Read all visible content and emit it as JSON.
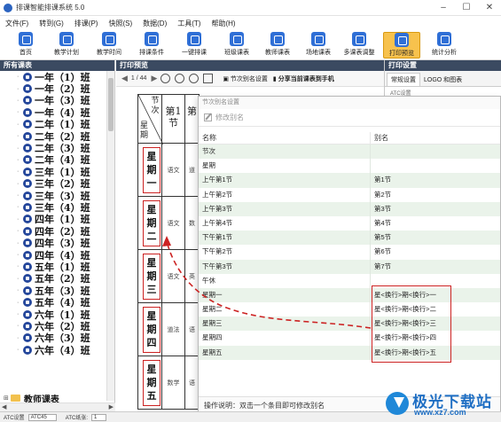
{
  "window": {
    "title": "排课智能排课系统 5.0"
  },
  "menu": [
    "文件(F)",
    "转到(G)",
    "排课(P)",
    "快照(S)",
    "数据(D)",
    "工具(T)",
    "帮助(H)"
  ],
  "toolbar": [
    {
      "label": "首页",
      "icon": "home-icon",
      "active": false
    },
    {
      "label": "教学计划",
      "icon": "plan-icon",
      "active": false
    },
    {
      "label": "教学时间",
      "icon": "clock-icon",
      "active": false
    },
    {
      "label": "排课条件",
      "icon": "conditions-icon",
      "active": false
    },
    {
      "label": "一键排课",
      "icon": "hand-icon",
      "active": false
    },
    {
      "label": "班级课表",
      "icon": "class-table-icon",
      "active": false
    },
    {
      "label": "教师课表",
      "icon": "teacher-icon",
      "active": false
    },
    {
      "label": "场地课表",
      "icon": "venue-icon",
      "active": false
    },
    {
      "label": "多课表调整",
      "icon": "adjust-icon",
      "active": false
    },
    {
      "label": "打印预览",
      "icon": "printer-icon",
      "active": true
    },
    {
      "label": "统计分析",
      "icon": "stats-icon",
      "active": false
    }
  ],
  "left_panel": {
    "header": "所有课表",
    "classes": [
      "一年（1）班",
      "一年（2）班",
      "一年（3）班",
      "一年（4）班",
      "二年（1）班",
      "二年（2）班",
      "二年（3）班",
      "二年（4）班",
      "三年（1）班",
      "三年（2）班",
      "三年（3）班",
      "三年（4）班",
      "四年（1）班",
      "四年（2）班",
      "四年（3）班",
      "四年（4）班",
      "五年（1）班",
      "五年（2）班",
      "五年（3）班",
      "五年（4）班",
      "六年（1）班",
      "六年（2）班",
      "六年（3）班",
      "六年（4）班"
    ],
    "folder": "教师课表"
  },
  "center_panel": {
    "header": "打印预览",
    "page_indicator": "1 / 44",
    "alias_button": "节次别名设置",
    "share_button": "分享当前课表到手机",
    "timetable": {
      "corner_top": "节次",
      "corner_bottom": "星期",
      "col1": "第1节",
      "col2": "第",
      "days": [
        "星期一",
        "星期二",
        "星期三",
        "星期四",
        "星期五"
      ],
      "subjects": [
        "语文",
        "语文",
        "语文",
        "道法",
        "数学"
      ],
      "subjects2": [
        "道",
        "数",
        "英",
        "语",
        "语"
      ]
    }
  },
  "right_panel": {
    "header": "打印设置",
    "tabs": [
      "常规设置",
      "LOGO 和图表"
    ],
    "label": "ATC设置"
  },
  "dialog": {
    "title": "节次别名设置",
    "edit_button": "修改别名",
    "col_name": "名称",
    "col_alias": "别名",
    "rows": [
      {
        "name": "节次",
        "alias": ""
      },
      {
        "name": "星期",
        "alias": ""
      },
      {
        "name": "上午第1节",
        "alias": "第1节"
      },
      {
        "name": "上午第2节",
        "alias": "第2节"
      },
      {
        "name": "上午第3节",
        "alias": "第3节"
      },
      {
        "name": "上午第4节",
        "alias": "第4节"
      },
      {
        "name": "下午第1节",
        "alias": "第5节"
      },
      {
        "name": "下午第2节",
        "alias": "第6节"
      },
      {
        "name": "下午第3节",
        "alias": "第7节"
      },
      {
        "name": "午休",
        "alias": ""
      },
      {
        "name": "星期一",
        "alias": "星<换行>期<换行>一"
      },
      {
        "name": "星期二",
        "alias": "星<换行>期<换行>二"
      },
      {
        "name": "星期三",
        "alias": "星<换行>期<换行>三"
      },
      {
        "name": "星期四",
        "alias": "星<换行>期<换行>四"
      },
      {
        "name": "星期五",
        "alias": "星<换行>期<换行>五"
      }
    ],
    "footer": "操作说明：双击一个条目即可修改别名"
  },
  "statusbar": {
    "left": "ATC设置",
    "sel1": "ATC45",
    "mid": "ATC纸张:",
    "sel2": "1"
  },
  "watermark": {
    "name": "极光下载站",
    "url": "www.xz7.com"
  },
  "colors": {
    "header_bg": "#3b4a61",
    "accent_blue": "#2f6fd6",
    "highlight_red": "#cc2222",
    "active_tool": "#f7c24d",
    "row_green": "#eaf3ea"
  }
}
